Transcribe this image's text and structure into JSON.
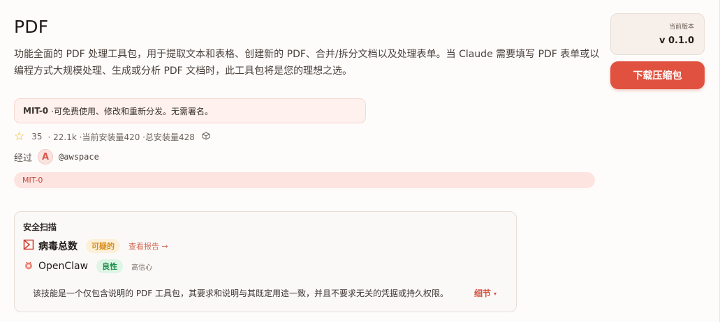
{
  "skill": {
    "title": "PDF",
    "description": "功能全面的 PDF 处理工具包，用于提取文本和表格、创建新的 PDF、合并/拆分文档以及处理表单。当 Claude 需要填写 PDF 表单或以编程方式大规模处理、生成或分析 PDF 文档时，此工具包将是您的理想之选。"
  },
  "license": {
    "name": "MIT-0",
    "text": "·可免费使用、修改和重新分发。无需署名。"
  },
  "stats": {
    "star_icon": "star-icon",
    "stars": "35",
    "summary": "· 22.1k ·当前安装量420 ·总安装量428",
    "package_icon": "package-icon"
  },
  "author": {
    "prefix": "经过",
    "avatar_letter": "A",
    "handle": "@awspace"
  },
  "tag": "MIT-0",
  "security_scan": {
    "heading": "安全扫描",
    "virustotal": {
      "name": "病毒总数",
      "status": "可疑的",
      "report_link": "查看报告 →"
    },
    "openclaw": {
      "name": "OpenClaw",
      "status": "良性",
      "confidence": "高信心"
    },
    "summary": "该技能是一个仅包含说明的 PDF 工具包，其要求和说明与其既定用途一致，并且不要求无关的凭据或持久权限。",
    "details_label": "细节",
    "details_caret": "▾"
  },
  "sidebar": {
    "version_label": "当前版本",
    "version_value": "v 0.1.0",
    "download_label": "下载压缩包"
  },
  "colors": {
    "accent": "#e0523f",
    "warning": "#d88a12",
    "success": "#1f8e4a"
  }
}
